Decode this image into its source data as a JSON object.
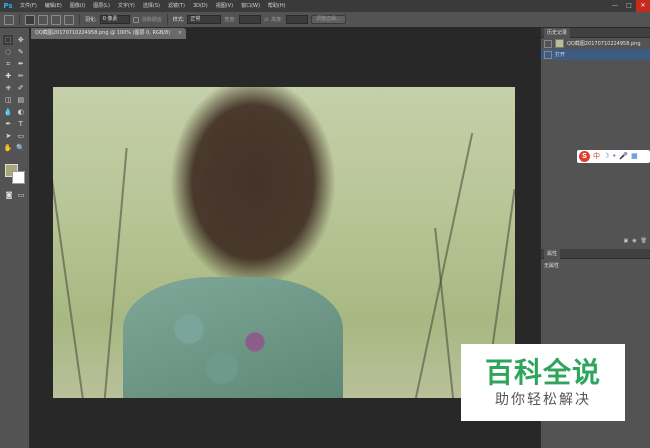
{
  "app": {
    "logo": "Ps"
  },
  "menu": {
    "items": [
      "文件(F)",
      "编辑(E)",
      "图像(I)",
      "图层(L)",
      "文字(Y)",
      "选择(S)",
      "滤镜(T)",
      "3D(D)",
      "视图(V)",
      "窗口(W)",
      "帮助(H)"
    ]
  },
  "window_controls": {
    "minimize": "—",
    "maximize": "□",
    "close": "✕"
  },
  "options_bar": {
    "feather_label": "羽化:",
    "feather_value": "0 像素",
    "antialias_label": "消除锯齿",
    "style_label": "样式:",
    "style_value": "正常",
    "width_label": "宽度:",
    "height_label": "高度:",
    "refine_button": "调整边缘..."
  },
  "toolbar": {
    "tools": [
      [
        "marquee-icon",
        "move-icon"
      ],
      [
        "lasso-icon",
        "quick-select-icon"
      ],
      [
        "crop-icon",
        "eyedropper-icon"
      ],
      [
        "healing-icon",
        "brush-icon"
      ],
      [
        "stamp-icon",
        "history-brush-icon"
      ],
      [
        "eraser-icon",
        "gradient-icon"
      ],
      [
        "blur-icon",
        "dodge-icon"
      ],
      [
        "pen-icon",
        "type-icon"
      ],
      [
        "path-select-icon",
        "rectangle-icon"
      ],
      [
        "hand-icon",
        "zoom-icon"
      ]
    ],
    "glyphs": [
      [
        "⬚",
        "✥"
      ],
      [
        "◌",
        "✎"
      ],
      [
        "⌗",
        "✒"
      ],
      [
        "✚",
        "✏"
      ],
      [
        "⎈",
        "✐"
      ],
      [
        "◫",
        "▤"
      ],
      [
        "💧",
        "◐"
      ],
      [
        "✒",
        "T"
      ],
      [
        "➤",
        "▭"
      ],
      [
        "✋",
        "🔍"
      ]
    ],
    "fg_color": "#a9a77a",
    "bg_color": "#ffffff"
  },
  "document": {
    "tab_title": "QQ截图20170710224958.png @ 100% (图层 0, RGB/8)",
    "tab_close": "×"
  },
  "history_panel": {
    "tab_label": "历史记录",
    "snapshot_name": "QQ截图20170710224958.png",
    "states": [
      "打开"
    ]
  },
  "properties_panel": {
    "tab_label": "属性",
    "body_text": "无属性"
  },
  "ime": {
    "logo": "S",
    "items": [
      "中",
      "☽",
      "•",
      "🎤",
      "▦"
    ]
  },
  "watermark": {
    "title": "百科全说",
    "subtitle": "助你轻松解决"
  }
}
